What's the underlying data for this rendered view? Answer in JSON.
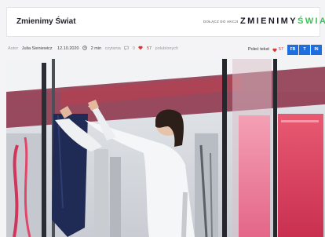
{
  "header": {
    "title": "Zmienimy Świat",
    "join_label": "DOŁĄCZ DO AKCJI",
    "logo_main": "ZMIENIMY",
    "logo_accent": "ŚWIAT"
  },
  "meta": {
    "author_prefix": "Autor",
    "author": "Julia Sieniewicz",
    "date": "12.10.2020",
    "read_time": "2 min",
    "read_suffix": "czytania",
    "comments": "0",
    "likes": "57",
    "likes_suffix": "polubionych"
  },
  "share": {
    "label": "Poleć tekst",
    "count": "57",
    "buttons": [
      "FB",
      "T",
      "IN"
    ]
  },
  "colors": {
    "accent_green": "#3fbf57",
    "share_blue": "#1d6fe0",
    "like_red": "#d33"
  }
}
